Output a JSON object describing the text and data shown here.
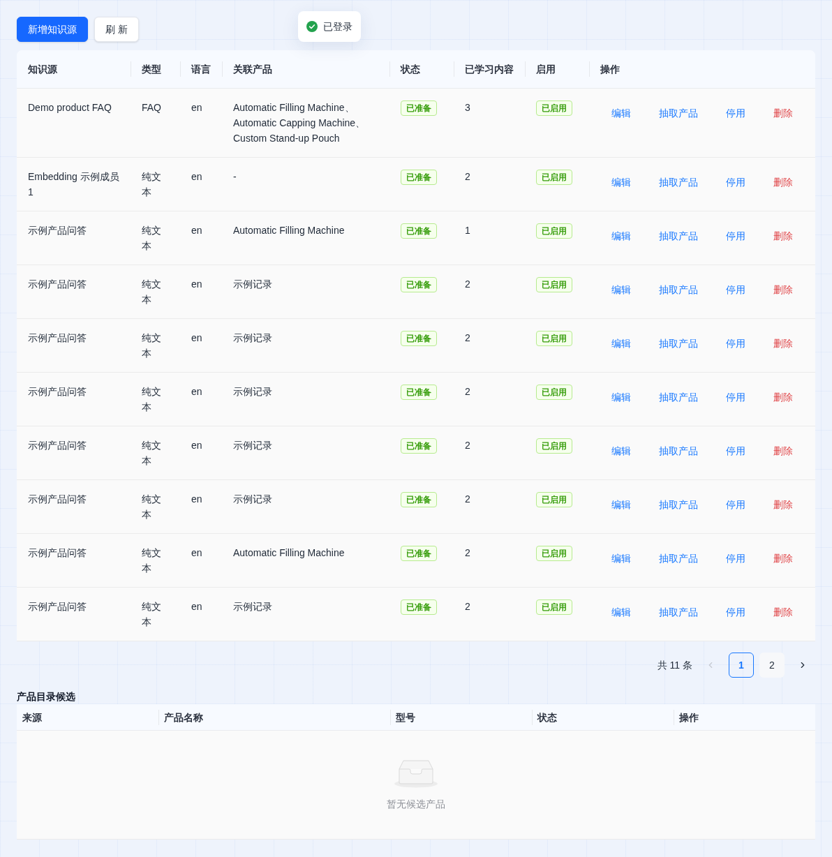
{
  "toolbar": {
    "buttons": [
      {
        "label": "新增知识源",
        "kind": "primary"
      },
      {
        "label": "刷 新",
        "kind": "default"
      }
    ]
  },
  "toast": {
    "kind": "success",
    "text": "已登录"
  },
  "knowledge_table": {
    "columns": [
      "知识源",
      "类型",
      "语言",
      "关联产品",
      "状态",
      "已学习内容",
      "启用",
      "操作"
    ],
    "rows": [
      {
        "source": "Demo product FAQ",
        "type": "FAQ",
        "language": "en",
        "products": "Automatic Filling Machine、Automatic Capping Machine、Custom Stand-up Pouch",
        "status": {
          "label": "已准备",
          "kind": "success"
        },
        "learned": "3",
        "enabled": {
          "label": "已启用",
          "kind": "success"
        },
        "actions": [
          {
            "label": "编辑",
            "kind": "link"
          },
          {
            "label": "抽取产品",
            "kind": "link"
          },
          {
            "label": "停用",
            "kind": "link"
          },
          {
            "label": "删除",
            "kind": "danger"
          }
        ]
      },
      {
        "source": "Embedding 示例成员 1",
        "type": "纯文本",
        "language": "en",
        "products": "-",
        "status": {
          "label": "已准备",
          "kind": "success"
        },
        "learned": "2",
        "enabled": {
          "label": "已启用",
          "kind": "success"
        },
        "actions": [
          {
            "label": "编辑",
            "kind": "link"
          },
          {
            "label": "抽取产品",
            "kind": "link"
          },
          {
            "label": "停用",
            "kind": "link"
          },
          {
            "label": "删除",
            "kind": "danger"
          }
        ]
      },
      {
        "source": "示例产品问答",
        "type": "纯文本",
        "language": "en",
        "products": "Automatic Filling Machine",
        "status": {
          "label": "已准备",
          "kind": "success"
        },
        "learned": "1",
        "enabled": {
          "label": "已启用",
          "kind": "success"
        },
        "actions": [
          {
            "label": "编辑",
            "kind": "link"
          },
          {
            "label": "抽取产品",
            "kind": "link"
          },
          {
            "label": "停用",
            "kind": "link"
          },
          {
            "label": "删除",
            "kind": "danger"
          }
        ]
      },
      {
        "source": "示例产品问答",
        "type": "纯文本",
        "language": "en",
        "products": "示例记录",
        "status": {
          "label": "已准备",
          "kind": "success"
        },
        "learned": "2",
        "enabled": {
          "label": "已启用",
          "kind": "success"
        },
        "actions": [
          {
            "label": "编辑",
            "kind": "link"
          },
          {
            "label": "抽取产品",
            "kind": "link"
          },
          {
            "label": "停用",
            "kind": "link"
          },
          {
            "label": "删除",
            "kind": "danger"
          }
        ]
      },
      {
        "source": "示例产品问答",
        "type": "纯文本",
        "language": "en",
        "products": "示例记录",
        "status": {
          "label": "已准备",
          "kind": "success"
        },
        "learned": "2",
        "enabled": {
          "label": "已启用",
          "kind": "success"
        },
        "actions": [
          {
            "label": "编辑",
            "kind": "link"
          },
          {
            "label": "抽取产品",
            "kind": "link"
          },
          {
            "label": "停用",
            "kind": "link"
          },
          {
            "label": "删除",
            "kind": "danger"
          }
        ]
      },
      {
        "source": "示例产品问答",
        "type": "纯文本",
        "language": "en",
        "products": "示例记录",
        "status": {
          "label": "已准备",
          "kind": "success"
        },
        "learned": "2",
        "enabled": {
          "label": "已启用",
          "kind": "success"
        },
        "actions": [
          {
            "label": "编辑",
            "kind": "link"
          },
          {
            "label": "抽取产品",
            "kind": "link"
          },
          {
            "label": "停用",
            "kind": "link"
          },
          {
            "label": "删除",
            "kind": "danger"
          }
        ]
      },
      {
        "source": "示例产品问答",
        "type": "纯文本",
        "language": "en",
        "products": "示例记录",
        "status": {
          "label": "已准备",
          "kind": "success"
        },
        "learned": "2",
        "enabled": {
          "label": "已启用",
          "kind": "success"
        },
        "actions": [
          {
            "label": "编辑",
            "kind": "link"
          },
          {
            "label": "抽取产品",
            "kind": "link"
          },
          {
            "label": "停用",
            "kind": "link"
          },
          {
            "label": "删除",
            "kind": "danger"
          }
        ]
      },
      {
        "source": "示例产品问答",
        "type": "纯文本",
        "language": "en",
        "products": "示例记录",
        "status": {
          "label": "已准备",
          "kind": "success"
        },
        "learned": "2",
        "enabled": {
          "label": "已启用",
          "kind": "success"
        },
        "actions": [
          {
            "label": "编辑",
            "kind": "link"
          },
          {
            "label": "抽取产品",
            "kind": "link"
          },
          {
            "label": "停用",
            "kind": "link"
          },
          {
            "label": "删除",
            "kind": "danger"
          }
        ]
      },
      {
        "source": "示例产品问答",
        "type": "纯文本",
        "language": "en",
        "products": "Automatic Filling Machine",
        "status": {
          "label": "已准备",
          "kind": "success"
        },
        "learned": "2",
        "enabled": {
          "label": "已启用",
          "kind": "success"
        },
        "actions": [
          {
            "label": "编辑",
            "kind": "link"
          },
          {
            "label": "抽取产品",
            "kind": "link"
          },
          {
            "label": "停用",
            "kind": "link"
          },
          {
            "label": "删除",
            "kind": "danger"
          }
        ]
      },
      {
        "source": "示例产品问答",
        "type": "纯文本",
        "language": "en",
        "products": "示例记录",
        "status": {
          "label": "已准备",
          "kind": "success"
        },
        "learned": "2",
        "enabled": {
          "label": "已启用",
          "kind": "success"
        },
        "actions": [
          {
            "label": "编辑",
            "kind": "link"
          },
          {
            "label": "抽取产品",
            "kind": "link"
          },
          {
            "label": "停用",
            "kind": "link"
          },
          {
            "label": "删除",
            "kind": "danger"
          }
        ]
      }
    ]
  },
  "pagination": {
    "total": "共 11 条",
    "prev": {
      "disabled": true
    },
    "pages": [
      {
        "label": "1",
        "selected": true
      },
      {
        "label": "2",
        "selected": false
      }
    ],
    "next": {
      "disabled": false
    }
  },
  "candidates": {
    "title": "产品目录候选",
    "columns": [
      "来源",
      "产品名称",
      "型号",
      "状态",
      "操作"
    ],
    "empty_text": "暂无候选产品"
  }
}
